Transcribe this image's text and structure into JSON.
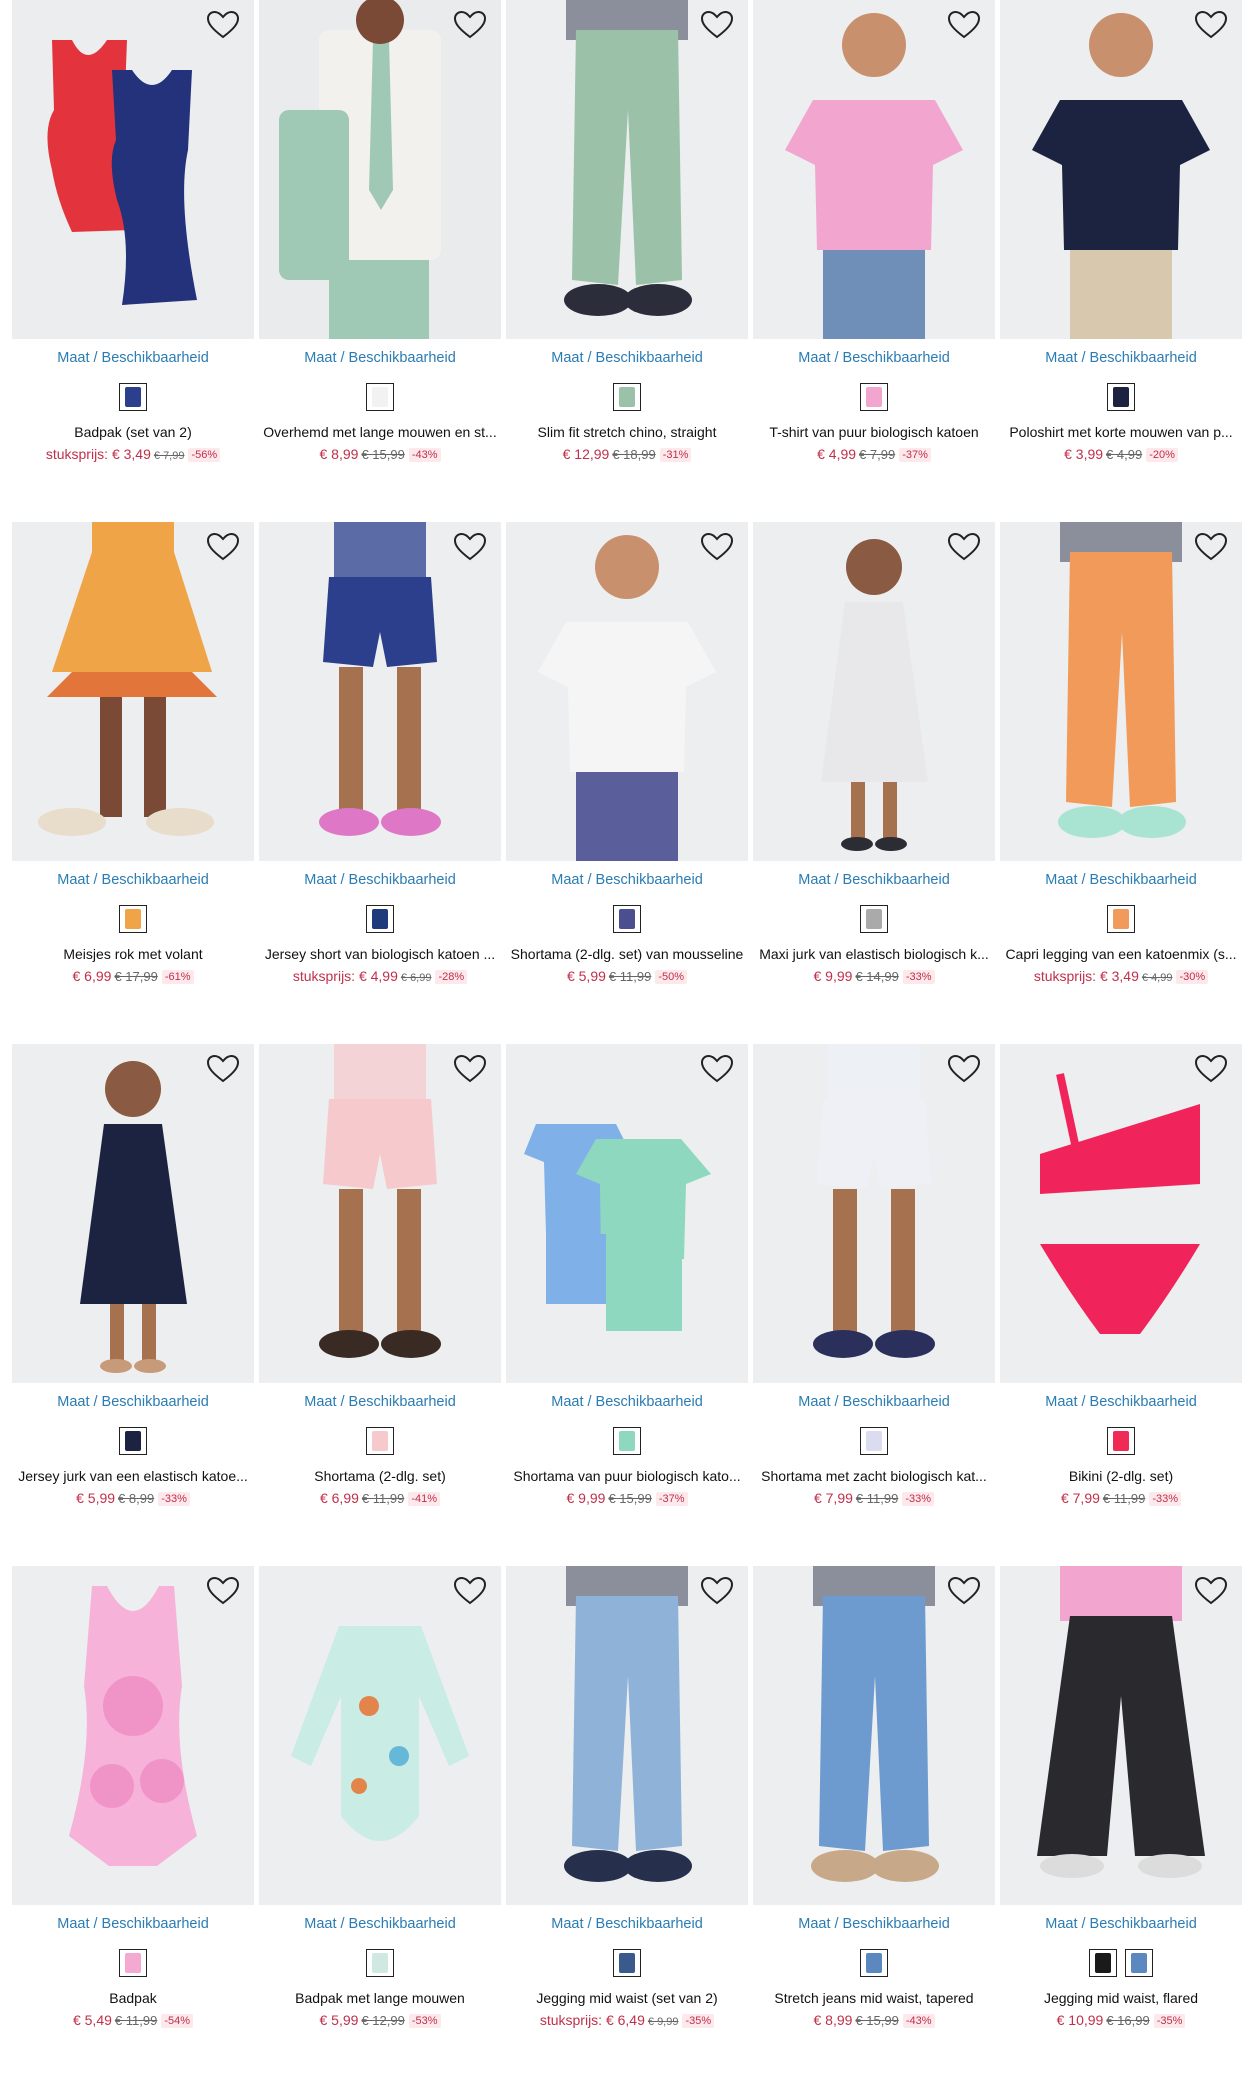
{
  "availability_label": "Maat / Beschikbaarheid",
  "products": [
    {
      "title": "Badpak (set van 2)",
      "prefix": "stuksprijs: ",
      "price": "€ 3,49",
      "old": "€ 7,99",
      "old_small": true,
      "discount": "-56%",
      "swatches": [
        "#2b3f8c"
      ],
      "bg": "#ecedef",
      "colors": [
        "#e3343e",
        "#23327a"
      ],
      "shape": "swim2"
    },
    {
      "title": "Overhemd met lange mouwen en st...",
      "prefix": "",
      "price": "€ 8,99",
      "old": "€ 15,99",
      "old_small": false,
      "discount": "-43%",
      "swatches": [
        "#f2f2f2"
      ],
      "bg": "#e9ebec",
      "colors": [
        "#f3f1ee",
        "#9fc9b5"
      ],
      "shape": "shirt"
    },
    {
      "title": "Slim fit stretch chino, straight",
      "prefix": "",
      "price": "€ 12,99",
      "old": "€ 18,99",
      "old_small": false,
      "discount": "-31%",
      "swatches": [
        "#9bc2a8"
      ],
      "bg": "#eceeef",
      "colors": [
        "#9bc2a8",
        "#2b2d3a"
      ],
      "shape": "pants"
    },
    {
      "title": "T-shirt van puur biologisch katoen",
      "prefix": "",
      "price": "€ 4,99",
      "old": "€ 7,99",
      "old_small": false,
      "discount": "-37%",
      "swatches": [
        "#f2a6cf"
      ],
      "bg": "#eceeef",
      "colors": [
        "#f2a6cf",
        "#6f8fb8"
      ],
      "shape": "tee"
    },
    {
      "title": "Poloshirt met korte mouwen van p...",
      "prefix": "",
      "price": "€ 3,99",
      "old": "€ 4,99",
      "old_small": false,
      "discount": "-20%",
      "swatches": [
        "#1c2340"
      ],
      "bg": "#eceeef",
      "colors": [
        "#1c2340",
        "#d8c9ae"
      ],
      "shape": "tee"
    },
    {
      "title": "Meisjes rok met volant",
      "prefix": "",
      "price": "€ 6,99",
      "old": "€ 17,99",
      "old_small": false,
      "discount": "-61%",
      "swatches": [
        "#f0a448"
      ],
      "bg": "#eceeef",
      "colors": [
        "#f0a448",
        "#6b3d2a"
      ],
      "shape": "skirt"
    },
    {
      "title": "Jersey short van biologisch katoen ...",
      "prefix": "stuksprijs: ",
      "price": "€ 4,99",
      "old": "€ 6,99",
      "old_small": true,
      "discount": "-28%",
      "swatches": [
        "#1e3a7a"
      ],
      "bg": "#eceeef",
      "colors": [
        "#2b3f8c",
        "#de78c6"
      ],
      "shape": "shorts"
    },
    {
      "title": "Shortama (2-dlg. set) van mousseline",
      "prefix": "",
      "price": "€ 5,99",
      "old": "€ 11,99",
      "old_small": false,
      "discount": "-50%",
      "swatches": [
        "#4b4f8f"
      ],
      "bg": "#eceeef",
      "colors": [
        "#f5f5f6",
        "#5a5e9a"
      ],
      "shape": "tee"
    },
    {
      "title": "Maxi jurk van elastisch biologisch k...",
      "prefix": "",
      "price": "€ 9,99",
      "old": "€ 14,99",
      "old_small": false,
      "discount": "-33%",
      "swatches": [
        "#aaaaaa"
      ],
      "bg": "#eceeef",
      "colors": [
        "#e8e8ea",
        "#2c2c34"
      ],
      "shape": "dress"
    },
    {
      "title": "Capri legging van een katoenmix (s...",
      "prefix": "stuksprijs: ",
      "price": "€ 3,49",
      "old": "€ 4,99",
      "old_small": true,
      "discount": "-30%",
      "swatches": [
        "#f19a5a"
      ],
      "bg": "#eceeef",
      "colors": [
        "#f19a5a",
        "#a9e3d2"
      ],
      "shape": "pants"
    },
    {
      "title": "Jersey jurk van een elastisch katoe...",
      "prefix": "",
      "price": "€ 5,99",
      "old": "€ 8,99",
      "old_small": false,
      "discount": "-33%",
      "swatches": [
        "#1c2340"
      ],
      "bg": "#eceeef",
      "colors": [
        "#1c2340",
        "#c79a7a"
      ],
      "shape": "dress"
    },
    {
      "title": "Shortama (2-dlg. set)",
      "prefix": "",
      "price": "€ 6,99",
      "old": "€ 11,99",
      "old_small": false,
      "discount": "-41%",
      "swatches": [
        "#f6c9cc"
      ],
      "bg": "#eceeef",
      "colors": [
        "#f6c9cc",
        "#3a2a24"
      ],
      "shape": "shorts"
    },
    {
      "title": "Shortama van puur biologisch kato...",
      "prefix": "",
      "price": "€ 9,99",
      "old": "€ 15,99",
      "old_small": false,
      "discount": "-37%",
      "swatches": [
        "#8fd8c0"
      ],
      "bg": "#eceeef",
      "colors": [
        "#8fd8c0",
        "#7fb0e8"
      ],
      "shape": "pj2"
    },
    {
      "title": "Shortama met zacht biologisch kat...",
      "prefix": "",
      "price": "€ 7,99",
      "old": "€ 11,99",
      "old_small": false,
      "discount": "-33%",
      "swatches": [
        "#dcdcf0"
      ],
      "bg": "#eceeef",
      "colors": [
        "#eef0f6",
        "#2a2f5c"
      ],
      "shape": "shorts"
    },
    {
      "title": "Bikini (2-dlg. set)",
      "prefix": "",
      "price": "€ 7,99",
      "old": "€ 11,99",
      "old_small": false,
      "discount": "-33%",
      "swatches": [
        "#ee2a55"
      ],
      "bg": "#eceeef",
      "colors": [
        "#f0245a",
        "#f0245a"
      ],
      "shape": "bikini"
    },
    {
      "title": "Badpak",
      "prefix": "",
      "price": "€ 5,49",
      "old": "€ 11,99",
      "old_small": false,
      "discount": "-54%",
      "swatches": [
        "#f4a9d2"
      ],
      "bg": "#eceeef",
      "colors": [
        "#f6b2d8",
        "#e02c55"
      ],
      "shape": "swim1"
    },
    {
      "title": "Badpak met lange mouwen",
      "prefix": "",
      "price": "€ 5,99",
      "old": "€ 12,99",
      "old_small": false,
      "discount": "-53%",
      "swatches": [
        "#cfe9e2"
      ],
      "bg": "#eceeef",
      "colors": [
        "#c9ece4",
        "#e3854b"
      ],
      "shape": "rashguard"
    },
    {
      "title": "Jegging mid waist (set van 2)",
      "prefix": "stuksprijs: ",
      "price": "€ 6,49",
      "old": "€ 9,99",
      "old_small": true,
      "discount": "-35%",
      "swatches": [
        "#3a5a8c"
      ],
      "bg": "#eceeef",
      "colors": [
        "#8fb3d8",
        "#26304c"
      ],
      "shape": "pants"
    },
    {
      "title": "Stretch jeans mid waist, tapered",
      "prefix": "",
      "price": "€ 8,99",
      "old": "€ 15,99",
      "old_small": false,
      "discount": "-43%",
      "swatches": [
        "#5a88bf"
      ],
      "bg": "#eceeef",
      "colors": [
        "#6d9bd0",
        "#c7a98a"
      ],
      "shape": "pants"
    },
    {
      "title": "Jegging mid waist, flared",
      "prefix": "",
      "price": "€ 10,99",
      "old": "€ 16,99",
      "old_small": false,
      "discount": "-35%",
      "swatches": [
        "#1a1a1a",
        "#5a88bf"
      ],
      "bg": "#eceeef",
      "colors": [
        "#2a2a2e",
        "#f2a6cf"
      ],
      "shape": "flare"
    }
  ]
}
